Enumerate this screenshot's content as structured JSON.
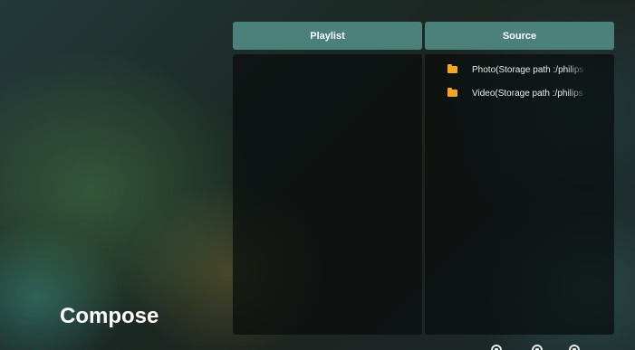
{
  "page": {
    "title": "Compose"
  },
  "columns": {
    "playlist": {
      "header": "Playlist",
      "items": []
    },
    "source": {
      "header": "Source",
      "items": [
        {
          "icon": "folder-icon",
          "label": "Photo(Storage path :/philips"
        },
        {
          "icon": "folder-icon",
          "label": "Video(Storage path :/philips"
        }
      ]
    }
  },
  "hint_bar": {
    "items": [
      {
        "icon": "remote-button-icon"
      },
      {
        "icon": "remote-button-icon"
      },
      {
        "icon": "remote-button-icon"
      }
    ]
  },
  "colors": {
    "header_bg": "#4b807b",
    "folder": "#f4a71d",
    "text": "#ffffff"
  }
}
